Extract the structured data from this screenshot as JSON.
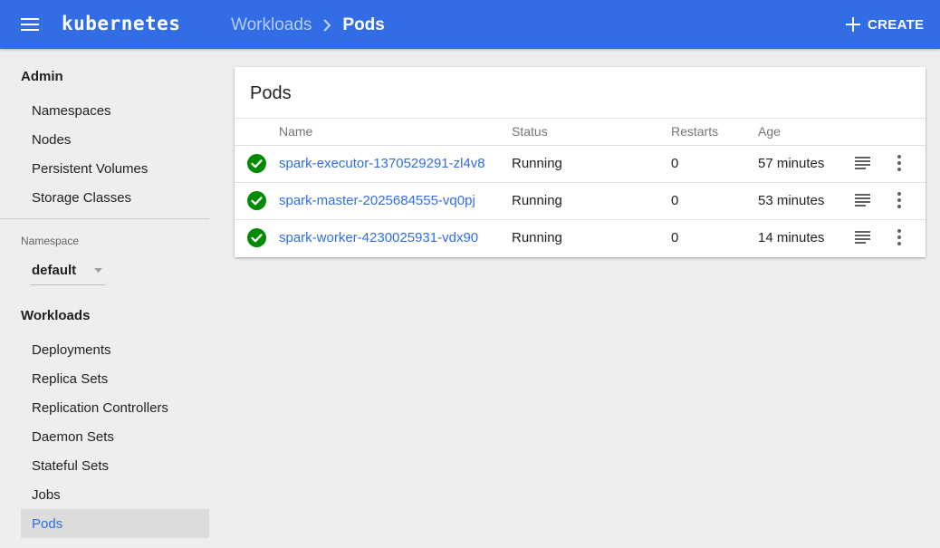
{
  "header": {
    "brand": "kubernetes",
    "breadcrumb": {
      "parent": "Workloads",
      "current": "Pods"
    },
    "create_label": "CREATE"
  },
  "sidebar": {
    "admin_heading": "Admin",
    "admin_items": [
      {
        "label": "Namespaces"
      },
      {
        "label": "Nodes"
      },
      {
        "label": "Persistent Volumes"
      },
      {
        "label": "Storage Classes"
      }
    ],
    "namespace_label": "Namespace",
    "namespace_value": "default",
    "workloads_heading": "Workloads",
    "workload_items": [
      {
        "label": "Deployments"
      },
      {
        "label": "Replica Sets"
      },
      {
        "label": "Replication Controllers"
      },
      {
        "label": "Daemon Sets"
      },
      {
        "label": "Stateful Sets"
      },
      {
        "label": "Jobs"
      },
      {
        "label": "Pods",
        "active": true
      }
    ]
  },
  "pods_card": {
    "title": "Pods",
    "columns": {
      "name": "Name",
      "status": "Status",
      "restarts": "Restarts",
      "age": "Age"
    },
    "rows": [
      {
        "name": "spark-executor-1370529291-zl4v8",
        "status": "Running",
        "restarts": "0",
        "age": "57 minutes"
      },
      {
        "name": "spark-master-2025684555-vq0pj",
        "status": "Running",
        "restarts": "0",
        "age": "53 minutes"
      },
      {
        "name": "spark-worker-4230025931-vdx90",
        "status": "Running",
        "restarts": "0",
        "age": "14 minutes"
      }
    ]
  },
  "icons": {
    "menu": "menu-icon",
    "breadcrumb_separator": "chevron-right-icon",
    "create": "plus-icon",
    "namespace_dropdown": "caret-down-icon",
    "status": "check-circle-icon",
    "logs": "logs-icon",
    "more": "more-vert-icon"
  },
  "colors": {
    "primary": "#326de6",
    "success": "#008a00",
    "background": "#eeeeee",
    "active_item_bg": "#dcdcdc"
  }
}
